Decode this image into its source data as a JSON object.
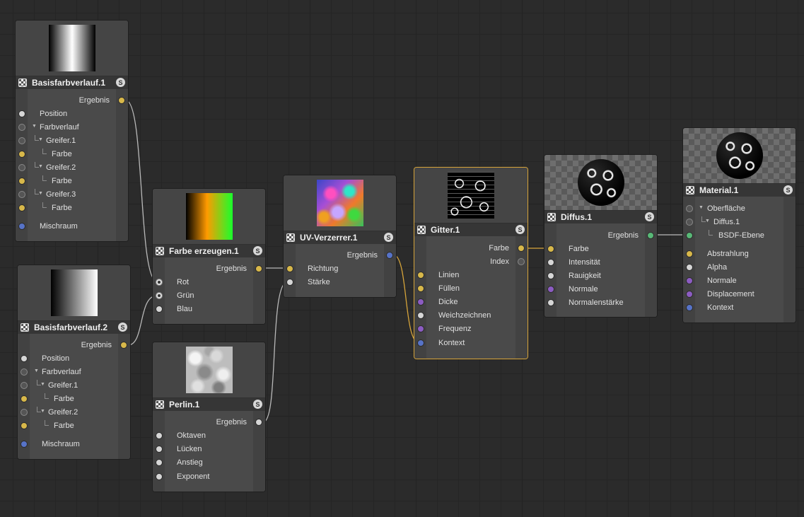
{
  "colors": {
    "yellow": "#d8b84a",
    "white": "#d6d6d6",
    "blue": "#5773c7",
    "purple": "#8c5cc2",
    "green": "#59b877",
    "empty": "#555555",
    "wire": "#b9b9b9",
    "wire_selected": "#d6a43a"
  },
  "nodes": {
    "basisfarbverlauf1": {
      "title": "Basisfarbverlauf.1",
      "solo": "S",
      "preview": "horizontal-gradient-black-white-black",
      "out": {
        "label": "Ergebnis",
        "port": "yellow"
      },
      "inputs": [
        {
          "label": "Position",
          "port": "white"
        },
        {
          "label": "Farbverlauf",
          "port": "empty",
          "expander": true
        },
        {
          "label": "Greifer.1",
          "port": "empty",
          "expander": true,
          "indent": 1
        },
        {
          "label": "Farbe",
          "port": "yellow",
          "indent": 2
        },
        {
          "label": "Greifer.2",
          "port": "empty",
          "expander": true,
          "indent": 1
        },
        {
          "label": "Farbe",
          "port": "yellow",
          "indent": 2
        },
        {
          "label": "Greifer.3",
          "port": "empty",
          "expander": true,
          "indent": 1
        },
        {
          "label": "Farbe",
          "port": "yellow",
          "indent": 2
        },
        {
          "label": "Mischraum",
          "port": "blue"
        }
      ]
    },
    "basisfarbverlauf2": {
      "title": "Basisfarbverlauf.2",
      "solo": "S",
      "preview": "horizontal-gradient-black-white",
      "out": {
        "label": "Ergebnis",
        "port": "yellow"
      },
      "inputs": [
        {
          "label": "Position",
          "port": "white"
        },
        {
          "label": "Farbverlauf",
          "port": "empty",
          "expander": true
        },
        {
          "label": "Greifer.1",
          "port": "empty",
          "expander": true,
          "indent": 1
        },
        {
          "label": "Farbe",
          "port": "yellow",
          "indent": 2
        },
        {
          "label": "Greifer.2",
          "port": "empty",
          "expander": true,
          "indent": 1
        },
        {
          "label": "Farbe",
          "port": "yellow",
          "indent": 2
        },
        {
          "label": "Mischraum",
          "port": "blue"
        }
      ]
    },
    "farbeerzeugen": {
      "title": "Farbe erzeugen.1",
      "solo": "S",
      "preview": "gradient-black-orange-green",
      "out": {
        "label": "Ergebnis",
        "port": "yellow"
      },
      "inputs": [
        {
          "label": "Rot",
          "port": "radio"
        },
        {
          "label": "Grün",
          "port": "radio"
        },
        {
          "label": "Blau",
          "port": "white"
        }
      ]
    },
    "perlin": {
      "title": "Perlin.1",
      "solo": "S",
      "preview": "perlin-noise",
      "out": {
        "label": "Ergebnis",
        "port": "white"
      },
      "inputs": [
        {
          "label": "Oktaven",
          "port": "white"
        },
        {
          "label": "Lücken",
          "port": "white"
        },
        {
          "label": "Anstieg",
          "port": "white"
        },
        {
          "label": "Exponent",
          "port": "white"
        }
      ]
    },
    "uvverzerrer": {
      "title": "UV-Verzerrer.1",
      "solo": "S",
      "preview": "distorted-colorful-texture",
      "out": {
        "label": "Ergebnis",
        "port": "blue"
      },
      "inputs": [
        {
          "label": "Richtung",
          "port": "yellow"
        },
        {
          "label": "Stärke",
          "port": "white"
        }
      ]
    },
    "gitter": {
      "title": "Gitter.1",
      "solo": "S",
      "preview": "black-white-grid-pattern",
      "outs": [
        {
          "label": "Farbe",
          "port": "yellow"
        },
        {
          "label": "Index",
          "port": "empty"
        }
      ],
      "inputs": [
        {
          "label": "Linien",
          "port": "yellow"
        },
        {
          "label": "Füllen",
          "port": "yellow"
        },
        {
          "label": "Dicke",
          "port": "purple"
        },
        {
          "label": "Weichzeichnen",
          "port": "white"
        },
        {
          "label": "Frequenz",
          "port": "purple"
        },
        {
          "label": "Kontext",
          "port": "blue"
        }
      ]
    },
    "diffus": {
      "title": "Diffus.1",
      "solo": "S",
      "preview": "sphere-pattern",
      "out": {
        "label": "Ergebnis",
        "port": "green"
      },
      "inputs": [
        {
          "label": "Farbe",
          "port": "yellow"
        },
        {
          "label": "Intensität",
          "port": "white"
        },
        {
          "label": "Rauigkeit",
          "port": "white"
        },
        {
          "label": "Normale",
          "port": "purple"
        },
        {
          "label": "Normalenstärke",
          "port": "white"
        }
      ]
    },
    "material": {
      "title": "Material.1",
      "solo": "S",
      "preview": "sphere-pattern",
      "inputs": [
        {
          "label": "Oberfläche",
          "port": "empty",
          "expander": true
        },
        {
          "label": "Diffus.1",
          "port": "empty",
          "expander": true,
          "indent": 1
        },
        {
          "label": "BSDF-Ebene",
          "port": "green",
          "indent": 2
        },
        {
          "label": "Abstrahlung",
          "port": "yellow"
        },
        {
          "label": "Alpha",
          "port": "white"
        },
        {
          "label": "Normale",
          "port": "purple"
        },
        {
          "label": "Displacement",
          "port": "purple"
        },
        {
          "label": "Kontext",
          "port": "blue"
        }
      ]
    }
  }
}
